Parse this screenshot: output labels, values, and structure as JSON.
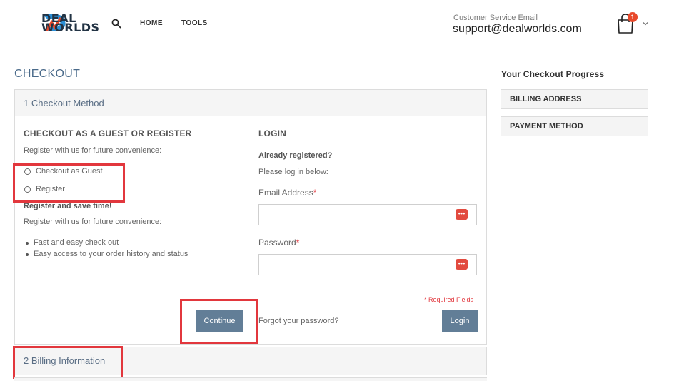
{
  "header": {
    "logo_line1": "DEAL",
    "logo_line2": "WORLDS",
    "nav": [
      "HOME",
      "TOOLS"
    ],
    "cs_label": "Customer Service Email",
    "cs_email": "support@dealworlds.com",
    "cart_count": "1"
  },
  "checkout": {
    "title": "CHECKOUT",
    "step1": "1 Checkout Method",
    "guest_section": {
      "title": "CHECKOUT AS A GUEST OR REGISTER",
      "intro": "Register with us for future convenience:",
      "options": [
        "Checkout as Guest",
        "Register"
      ],
      "save_time": "Register and save time!",
      "intro2": "Register with us for future convenience:",
      "benefits": [
        "Fast and easy check out",
        "Easy access to your order history and status"
      ],
      "continue_label": "Continue"
    },
    "login_section": {
      "title": "LOGIN",
      "already": "Already registered?",
      "please": "Please log in below:",
      "email_label": "Email Address",
      "email_value": "",
      "password_label": "Password",
      "password_value": "",
      "star": "*",
      "required_fields": "* Required Fields",
      "forgot": "Forgot your password?",
      "login_label": "Login"
    },
    "step2": "2 Billing Information"
  },
  "sidebar": {
    "title": "Your Checkout Progress",
    "items": [
      "BILLING ADDRESS",
      "PAYMENT METHOD"
    ]
  },
  "colors": {
    "accent": "#627e97",
    "highlight": "#e2373d",
    "title": "#4a6a8a"
  }
}
